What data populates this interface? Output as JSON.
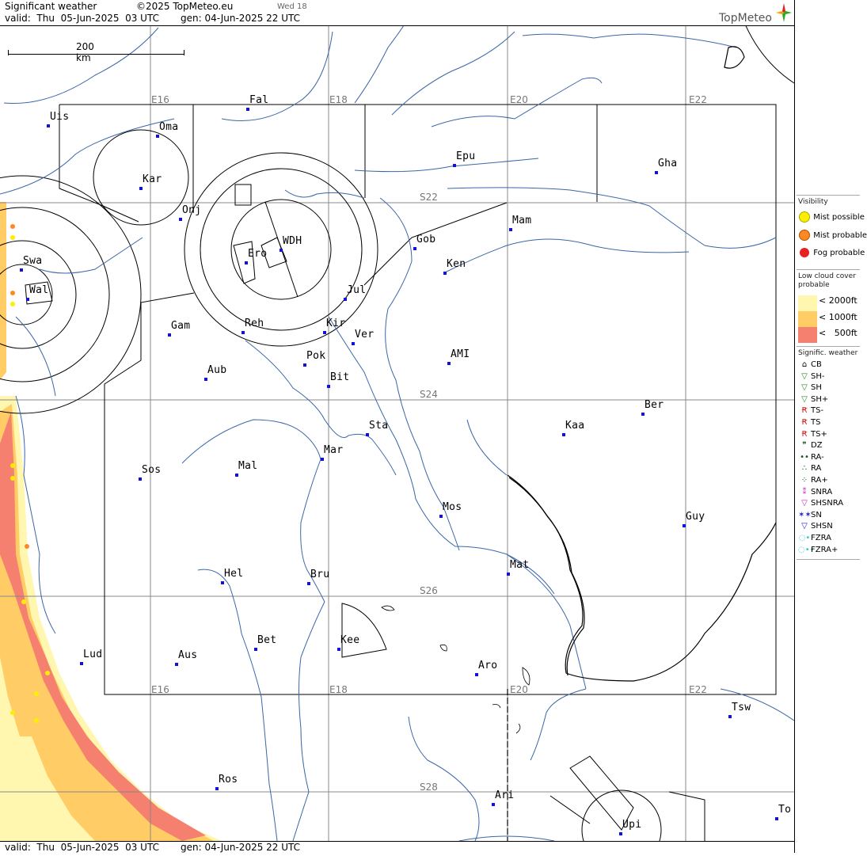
{
  "header": {
    "title": "Significant weather",
    "copyright": "©2025 TopMeteo.eu",
    "weekday": "Wed 18",
    "valid": "valid:  Thu  05-Jun-2025  03 UTC",
    "generated": "gen: 04-Jun-2025 22 UTC",
    "brand": "TopMeteo"
  },
  "footer": {
    "valid": "valid:  Thu  05-Jun-2025  03 UTC",
    "generated": "gen: 04-Jun-2025 22 UTC"
  },
  "scale": {
    "label": "200 km"
  },
  "grid": {
    "lon_labels_top": [
      "E16",
      "E18",
      "E20",
      "E22"
    ],
    "lon_labels_bottom": [
      "E16",
      "E18",
      "E20",
      "E22"
    ],
    "lat_labels": [
      "S22",
      "S24",
      "S26",
      "S28"
    ]
  },
  "cities": [
    "Uis",
    "Fal",
    "Oma",
    "Kar",
    "Onj",
    "Swa",
    "Wal",
    "Ero",
    "WDH",
    "Jul",
    "Gob",
    "Ken",
    "Mam",
    "Epu",
    "Gha",
    "Gam",
    "Reh",
    "Kir",
    "Ver",
    "Pok",
    "Bit",
    "AMI",
    "Aub",
    "Sta",
    "Kaa",
    "Ber",
    "Sos",
    "Mal",
    "Mar",
    "Mos",
    "Guy",
    "Hel",
    "Bru",
    "Mat",
    "Bet",
    "Kee",
    "Aro",
    "Lud",
    "Aus",
    "Tsw",
    "Ros",
    "Ari",
    "To",
    "Upi"
  ],
  "legend": {
    "visibility": {
      "title": "Visibility",
      "items": [
        {
          "label": "Mist possible",
          "color": "#ffee00"
        },
        {
          "label": "Mist probable",
          "color": "#ff8822"
        },
        {
          "label": "Fog probable",
          "color": "#e82020"
        }
      ]
    },
    "cloud": {
      "title": "Low cloud cover probable",
      "items": [
        {
          "label": "< 2000ft",
          "color": "#fff6b0"
        },
        {
          "label": "< 1000ft",
          "color": "#ffcc66"
        },
        {
          "label": "<   500ft",
          "color": "#f58070"
        }
      ]
    },
    "weather": {
      "title": "Signific. weather",
      "items": [
        {
          "label": "CB",
          "symbol": "⌂",
          "color": "#000000"
        },
        {
          "label": "SH-",
          "symbol": "▽",
          "color": "#228822"
        },
        {
          "label": "SH",
          "symbol": "▽",
          "color": "#228822"
        },
        {
          "label": "SH+",
          "symbol": "▽",
          "color": "#228822"
        },
        {
          "label": "TS-",
          "symbol": "Ꞧ",
          "color": "#cc2222"
        },
        {
          "label": "TS",
          "symbol": "Ꞧ",
          "color": "#cc2222"
        },
        {
          "label": "TS+",
          "symbol": "Ꞧ",
          "color": "#cc2222"
        },
        {
          "label": "DZ",
          "symbol": "❞",
          "color": "#115511"
        },
        {
          "label": "RA-",
          "symbol": "••",
          "color": "#115511"
        },
        {
          "label": "RA",
          "symbol": "∴",
          "color": "#115511"
        },
        {
          "label": "RA+",
          "symbol": "⁘",
          "color": "#115511"
        },
        {
          "label": "SNRA",
          "symbol": "⁑",
          "color": "#cc22cc"
        },
        {
          "label": "SHSNRA",
          "symbol": "▽",
          "color": "#cc22cc"
        },
        {
          "label": "SN",
          "symbol": "✶✶",
          "color": "#2222cc"
        },
        {
          "label": "SHSN",
          "symbol": "▽",
          "color": "#2222cc"
        },
        {
          "label": "FZRA",
          "symbol": "◌•",
          "color": "#22cccc"
        },
        {
          "label": "FZRA+",
          "symbol": "◌••",
          "color": "#22cccc"
        }
      ]
    }
  }
}
